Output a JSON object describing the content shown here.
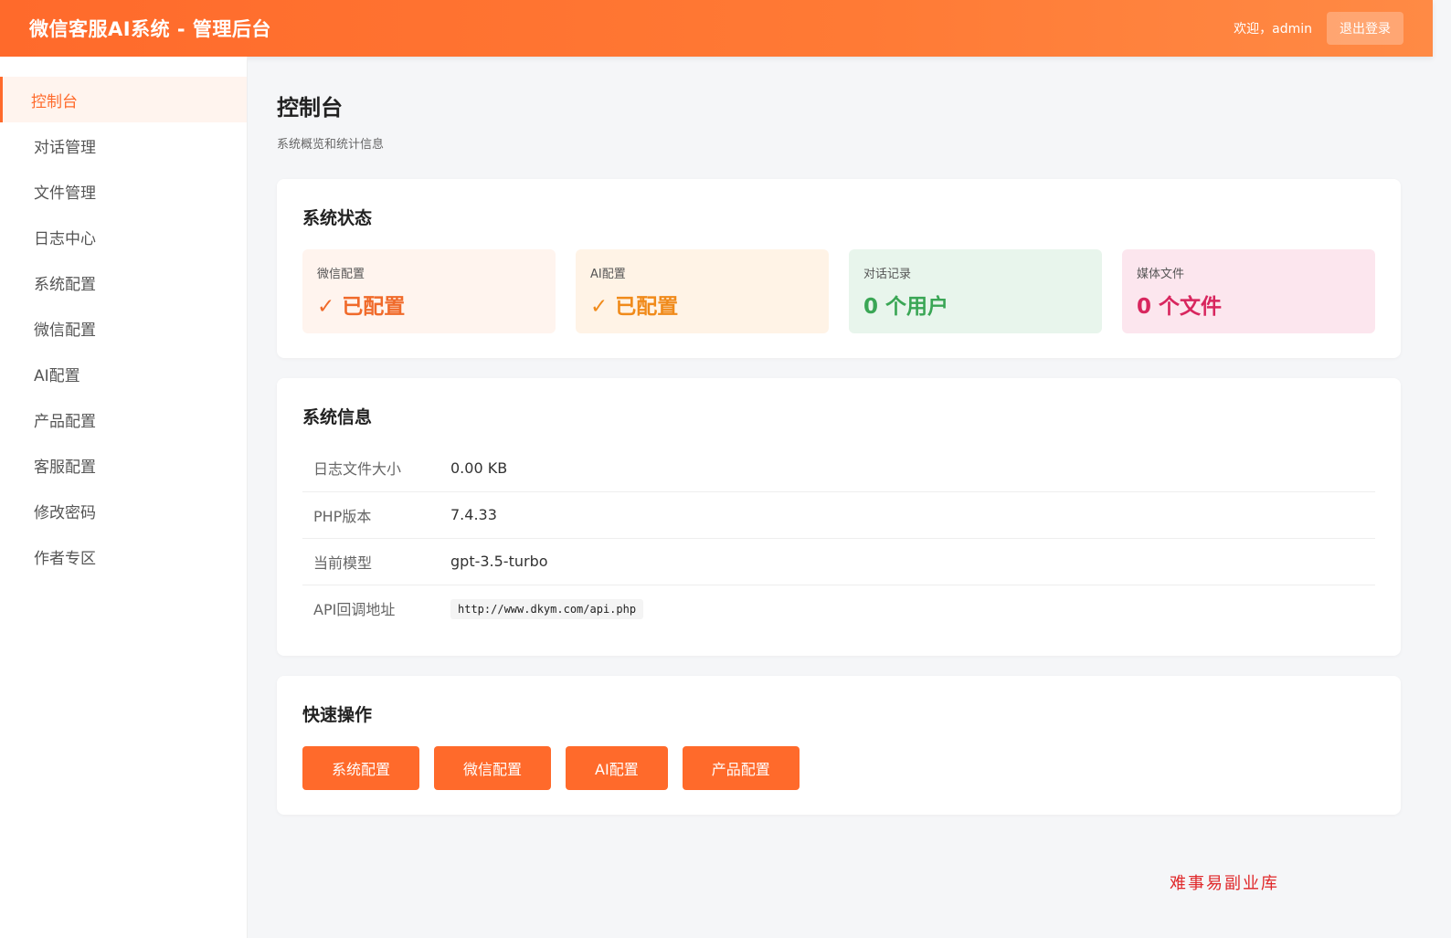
{
  "header": {
    "title": "微信客服AI系统 - 管理后台",
    "welcome": "欢迎，admin",
    "logout_label": "退出登录"
  },
  "sidebar": {
    "items": [
      {
        "label": "控制台"
      },
      {
        "label": "对话管理"
      },
      {
        "label": "文件管理"
      },
      {
        "label": "日志中心"
      },
      {
        "label": "系统配置"
      },
      {
        "label": "微信配置"
      },
      {
        "label": "AI配置"
      },
      {
        "label": "产品配置"
      },
      {
        "label": "客服配置"
      },
      {
        "label": "修改密码"
      },
      {
        "label": "作者专区"
      }
    ]
  },
  "page": {
    "title": "控制台",
    "subtitle": "系统概览和统计信息"
  },
  "status": {
    "title": "系统状态",
    "cards": [
      {
        "label": "微信配置",
        "value": "✓ 已配置",
        "bg": "#fff4ee",
        "color": "#f06a2a"
      },
      {
        "label": "AI配置",
        "value": "✓ 已配置",
        "bg": "#fff3e6",
        "color": "#f08a1a"
      },
      {
        "label": "对话记录",
        "value": "0 个用户",
        "bg": "#e8f5ec",
        "color": "#3aa655"
      },
      {
        "label": "媒体文件",
        "value": "0 个文件",
        "bg": "#fce6ee",
        "color": "#d8265e"
      }
    ]
  },
  "info": {
    "title": "系统信息",
    "rows": [
      {
        "key": "日志文件大小",
        "value": "0.00 KB"
      },
      {
        "key": "PHP版本",
        "value": "7.4.33"
      },
      {
        "key": "当前模型",
        "value": "gpt-3.5-turbo"
      },
      {
        "key": "API回调地址",
        "value": "http://www.dkym.com/api.php"
      }
    ]
  },
  "quick": {
    "title": "快速操作",
    "buttons": [
      {
        "label": "系统配置"
      },
      {
        "label": "微信配置"
      },
      {
        "label": "AI配置"
      },
      {
        "label": "产品配置"
      }
    ]
  },
  "watermark": "难事易副业库",
  "colors": {
    "accent": "#ff6a2b"
  }
}
